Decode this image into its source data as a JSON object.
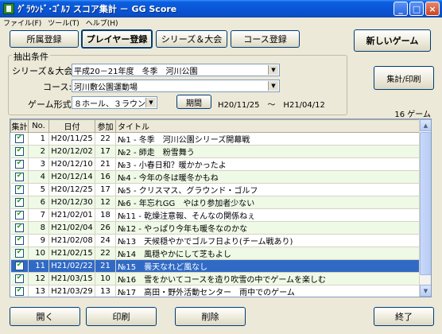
{
  "window": {
    "title": "ｸﾞﾗｳﾝﾄﾞ･ｺﾞﾙﾌ スコア集計 － GG Score",
    "minimize": "_",
    "maximize": "□",
    "close": "×"
  },
  "menu": [
    "ファイル(F)",
    "ツール(T)",
    "ヘルプ(H)"
  ],
  "tabs": [
    "所属登録",
    "プレイヤー登録",
    "シリーズ＆大会",
    "コース登録"
  ],
  "new_game_label": "新しいゲーム",
  "filter": {
    "group_label": "抽出条件",
    "series_label": "シリーズ＆大会:",
    "series_value": "平成20－21年度　冬季　河川公園",
    "course_label": "コース:",
    "course_value": "河川敷公園運動場",
    "format_label": "ゲーム形式:",
    "format_value": "８ホール、３ラウンド",
    "period_button": "期間",
    "period_text": "H20/11/25　～　H21/04/12"
  },
  "print_button": "集計/印刷",
  "count_text": "16 ゲーム",
  "table": {
    "columns": [
      "集計",
      "No.",
      "日付",
      "参加",
      "タイトル"
    ],
    "rows": [
      {
        "no": "1",
        "date": "H20/11/25",
        "count": "22",
        "title": "№1 - 冬季　河川公園シリーズ開幕戦",
        "checked": true,
        "selected": false
      },
      {
        "no": "2",
        "date": "H20/12/02",
        "count": "17",
        "title": "№2 - 師走　粉雪舞う",
        "checked": true,
        "selected": false
      },
      {
        "no": "3",
        "date": "H20/12/10",
        "count": "21",
        "title": "№3 - 小春日和？暖かかったよ",
        "checked": true,
        "selected": false
      },
      {
        "no": "4",
        "date": "H20/12/14",
        "count": "16",
        "title": "№4 - 今年の冬は暖冬かもね",
        "checked": true,
        "selected": false
      },
      {
        "no": "5",
        "date": "H20/12/25",
        "count": "17",
        "title": "№5 - クリスマス、グラウンド・ゴルフ",
        "checked": true,
        "selected": false
      },
      {
        "no": "6",
        "date": "H20/12/30",
        "count": "12",
        "title": "№6 - 年忘れGG　やはり参加者少ない",
        "checked": true,
        "selected": false
      },
      {
        "no": "7",
        "date": "H21/02/01",
        "count": "18",
        "title": "№11 - 乾燥注意報、そんなの関係ねぇ",
        "checked": true,
        "selected": false
      },
      {
        "no": "8",
        "date": "H21/02/04",
        "count": "26",
        "title": "№12 - やっぱり今年も暖冬なのかな",
        "checked": true,
        "selected": false
      },
      {
        "no": "9",
        "date": "H21/02/08",
        "count": "24",
        "title": "№13　天候穏やかでゴルフ日より(チーム戦あり)",
        "checked": true,
        "selected": false
      },
      {
        "no": "10",
        "date": "H21/02/15",
        "count": "22",
        "title": "№14　風穏やかにして芝もよし",
        "checked": true,
        "selected": false
      },
      {
        "no": "11",
        "date": "H21/02/22",
        "count": "21",
        "title": "№15　曇天なれど風なし",
        "checked": true,
        "selected": true
      },
      {
        "no": "12",
        "date": "H21/03/15",
        "count": "10",
        "title": "№16　雪をかいてコースを造り吹雪の中でゲームを楽しむ",
        "checked": true,
        "selected": false
      },
      {
        "no": "13",
        "date": "H21/03/29",
        "count": "13",
        "title": "№17　高田・野外活動センター　雨中でのゲーム",
        "checked": true,
        "selected": false
      }
    ]
  },
  "bottom_buttons": {
    "open": "開く",
    "print": "印刷",
    "delete": "削除",
    "exit": "終了"
  }
}
